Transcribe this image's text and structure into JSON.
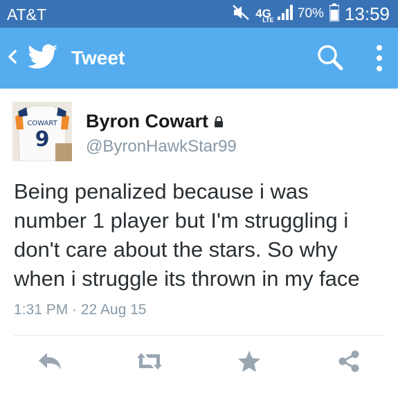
{
  "status_bar": {
    "carrier": "AT&T",
    "network": "4G",
    "network_sub": "LTE",
    "battery": "70%",
    "time": "13:59",
    "icons": [
      "mute-icon",
      "signal-icon",
      "battery-icon"
    ]
  },
  "header": {
    "title": "Tweet",
    "icons": [
      "back-chevron-icon",
      "twitter-bird-icon",
      "search-icon",
      "more-vertical-icon"
    ]
  },
  "tweet": {
    "author_name": "Byron Cowart",
    "author_handle": "@ByronHawkStar99",
    "avatar_jersey_name": "COWART",
    "avatar_jersey_number": "9",
    "text_lines": [
      "Being penalized because i was",
      "number 1 player but I'm struggling i",
      "don't care about the stars. So why",
      "when i struggle its thrown in my face"
    ],
    "timestamp": "1:31 PM · 22 Aug 15"
  },
  "actions": [
    "reply-icon",
    "retweet-icon",
    "favorite-star-icon",
    "share-icon"
  ],
  "colors": {
    "status_bar": "#3a73b5",
    "header": "#55acee",
    "muted_text": "#8899a6",
    "action_icon": "#9aa6b2"
  }
}
